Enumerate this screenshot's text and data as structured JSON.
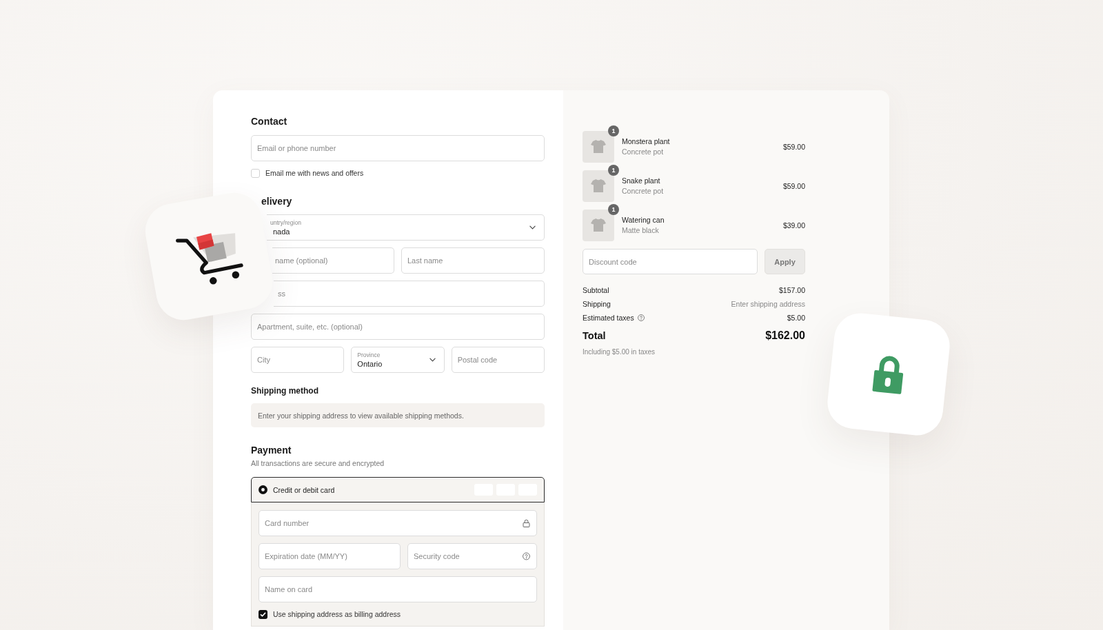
{
  "contact": {
    "heading": "Contact",
    "email": {
      "placeholder": "Email or phone number"
    },
    "newsletter": {
      "label": "Email me with news and offers",
      "checked": false
    }
  },
  "delivery": {
    "heading": "elivery",
    "country": {
      "label": "untry/region",
      "value": "nada"
    },
    "first_name": {
      "placeholder": "name (optional)"
    },
    "last_name": {
      "placeholder": "Last name"
    },
    "address": {
      "placeholder": "ss"
    },
    "apartment": {
      "placeholder": "Apartment, suite, etc. (optional)"
    },
    "city": {
      "placeholder": "City"
    },
    "province": {
      "label": "Province",
      "value": "Ontario"
    },
    "postal_code": {
      "placeholder": "Postal code"
    }
  },
  "shipping_method": {
    "heading": "Shipping method",
    "notice": "Enter your shipping address to view available shipping methods."
  },
  "payment": {
    "heading": "Payment",
    "subtitle": "All transactions are secure and encrypted",
    "method": {
      "label": "Credit or debit card",
      "selected": true
    },
    "card_number": {
      "placeholder": "Card number"
    },
    "expiration": {
      "placeholder": "Expiration date (MM/YY)"
    },
    "security_code": {
      "placeholder": "Security code"
    },
    "name_on_card": {
      "placeholder": "Name on card"
    },
    "billing_same": {
      "label": "Use shipping address as billing address",
      "checked": true
    }
  },
  "summary": {
    "items": [
      {
        "name": "Monstera plant",
        "variant": "Concrete pot",
        "price": "$59.00",
        "quantity": "1"
      },
      {
        "name": "Snake plant",
        "variant": "Concrete pot",
        "price": "$59.00",
        "quantity": "1"
      },
      {
        "name": "Watering can",
        "variant": "Matte black",
        "price": "$39.00",
        "quantity": "1"
      }
    ],
    "discount": {
      "placeholder": "Discount code",
      "button": {
        "label": "Apply",
        "disabled": true
      }
    },
    "lines": [
      {
        "kind": "plain",
        "label": "Subtotal",
        "value": "$157.00"
      },
      {
        "kind": "pending",
        "label": "Shipping",
        "value": "Enter shipping address"
      },
      {
        "kind": "help",
        "label": "Estimated taxes",
        "value": "$5.00"
      }
    ],
    "total": {
      "label": "Total",
      "value": "$162.00",
      "note": "Including $5.00 in taxes"
    }
  }
}
